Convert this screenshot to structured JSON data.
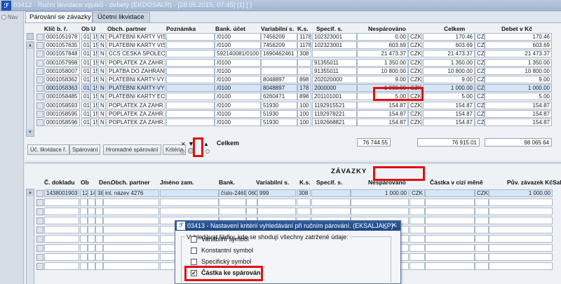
{
  "window": {
    "title": "03412 - Ruční likvidace výpisů - debety (EKDOSALR) - [28.05.2015, 07:45] [1] [ ]"
  },
  "nav": {
    "label": "Nav"
  },
  "tabs": [
    {
      "label": "Párování se závazky"
    },
    {
      "label": "Účetní likvidace"
    }
  ],
  "top_grid": {
    "headers": [
      "Klíč b. ř.",
      "Ob",
      "U",
      "Obch. partner",
      "Poznámka",
      "Bank. účet",
      "Variabilní s.",
      "K.s.",
      "Specif. s.",
      "Nespárováno",
      "Celkem",
      "Debet v Kč"
    ],
    "rows": [
      [
        "0001051978",
        "01",
        "15",
        "N",
        "PLATEBNI KARTY VISA",
        "",
        "/0100",
        "7456209",
        "1178",
        "102323001",
        "0.00",
        "CZK",
        "170.46",
        "CZK",
        "170.46"
      ],
      [
        "0001057635",
        "01",
        "15",
        "N",
        "PLATEBNI KARTY VISA",
        "",
        "/0100",
        "7456209",
        "1178",
        "102323001",
        "603.69",
        "CZK",
        "603.69",
        "CZK",
        "603.69"
      ],
      [
        "0001057848",
        "01",
        "15",
        "N",
        "CCS CESKA SPOLECN",
        "",
        "592140081/0100",
        "1690462461",
        "308",
        "",
        "21 473.37",
        "CZK",
        "21 473.37",
        "CZK",
        "21 473.37"
      ],
      [
        "0001057998",
        "01",
        "15",
        "N",
        "POPLATEK ZA ZAHR.",
        "",
        "/0100",
        "",
        "",
        "91355011",
        "1 350.00",
        "CZK",
        "1 350.00",
        "CZK",
        "1 350.00"
      ],
      [
        "0001058007",
        "01",
        "15",
        "N",
        "PLATBA DO ZAHRANI",
        "",
        "/0100",
        "",
        "",
        "91355011",
        "10 800.00",
        "CZK",
        "10 800.00",
        "CZK",
        "10 800.00"
      ],
      [
        "0001058362",
        "01",
        "15",
        "N",
        "PLATEBNI KARTY-VYB",
        "",
        "/0100",
        "8048897",
        "898",
        "202020000",
        "9.00",
        "CZK",
        "9.00",
        "CZK",
        "9.00"
      ],
      [
        "0001058363",
        "01",
        "15",
        "N",
        "PLATEBNI KARTY-VYB",
        "",
        "/0100",
        "8048897",
        "178",
        "2000000",
        "1 000.00",
        "CZK",
        "1 000.00",
        "CZK",
        "1 000.00"
      ],
      [
        "0001058485",
        "01",
        "15",
        "N",
        "PLATEBNI KARTY EC/M",
        "",
        "/0100",
        "6260471",
        "898",
        "201101001",
        "5.00",
        "CZK",
        "5.00",
        "CZK",
        "5.00"
      ],
      [
        "0001058593",
        "01",
        "15",
        "N",
        "POPLATEK ZA ZAHR.",
        "",
        "/0100",
        "51930",
        "100",
        "1192915521",
        "154.87",
        "CZK",
        "154.87",
        "CZK",
        "154.87"
      ],
      [
        "0001058595",
        "01",
        "15",
        "N",
        "POPLATEK ZA ZAHR.",
        "",
        "/0100",
        "51930",
        "100",
        "1192978221",
        "154.87",
        "CZK",
        "154.87",
        "CZK",
        "154.87"
      ],
      [
        "0001058596",
        "01",
        "15",
        "N",
        "POPLATEK ZA ZAHR.",
        "",
        "/0100",
        "51930",
        "100",
        "1192668821",
        "154.87",
        "CZK",
        "154.87",
        "CZK",
        "154.87"
      ]
    ],
    "selected_row": 6
  },
  "buttons": {
    "uc_likvidace": "Úč. likvidace ř.",
    "parovani": "Spárování",
    "hromadne": "Hromadné spárování",
    "kriteria": "Kritéria"
  },
  "totals": {
    "label": "Celkem",
    "nesparovano": "76 744.55",
    "celkem": "76 915.01",
    "debet": "98 065.64"
  },
  "zavazky": {
    "title": "ZÁVAZKY",
    "headers": [
      "Č. dokladu",
      "Ob",
      "Den.",
      "Obch. partner",
      "Jméno zam.",
      "Bank.",
      "Variabilní s.",
      "K.s.",
      "Specif. s.",
      "Nespárováno",
      "Částka v cizí měně",
      "Pův. závazek Kč",
      "Sal"
    ],
    "row": [
      "1438001903",
      "12",
      "14",
      "380",
      "int. název 4276",
      "",
      "číslo-2469",
      "0600",
      "999",
      "308",
      "",
      "1 000.00",
      "CZK",
      "",
      "CZK",
      "1 000.00"
    ]
  },
  "dialog": {
    "title": "03413 - Nastavení kritérií vyhledávání při ručním párování. (EKSALJAKP) -",
    "group_label": "Vyhledávat řádky, kde se shodují všechny zatržené údaje:",
    "options": [
      {
        "label": "Variabilní symbol",
        "checked": false
      },
      {
        "label": "Konstantní symbol",
        "checked": false
      },
      {
        "label": "Specifický symbol",
        "checked": false
      },
      {
        "label": "Částka ke spárování",
        "checked": true
      }
    ]
  },
  "colors": {
    "accent": "#1d4785",
    "highlight": "#e01010",
    "selected_row": "#d6e6f8"
  }
}
